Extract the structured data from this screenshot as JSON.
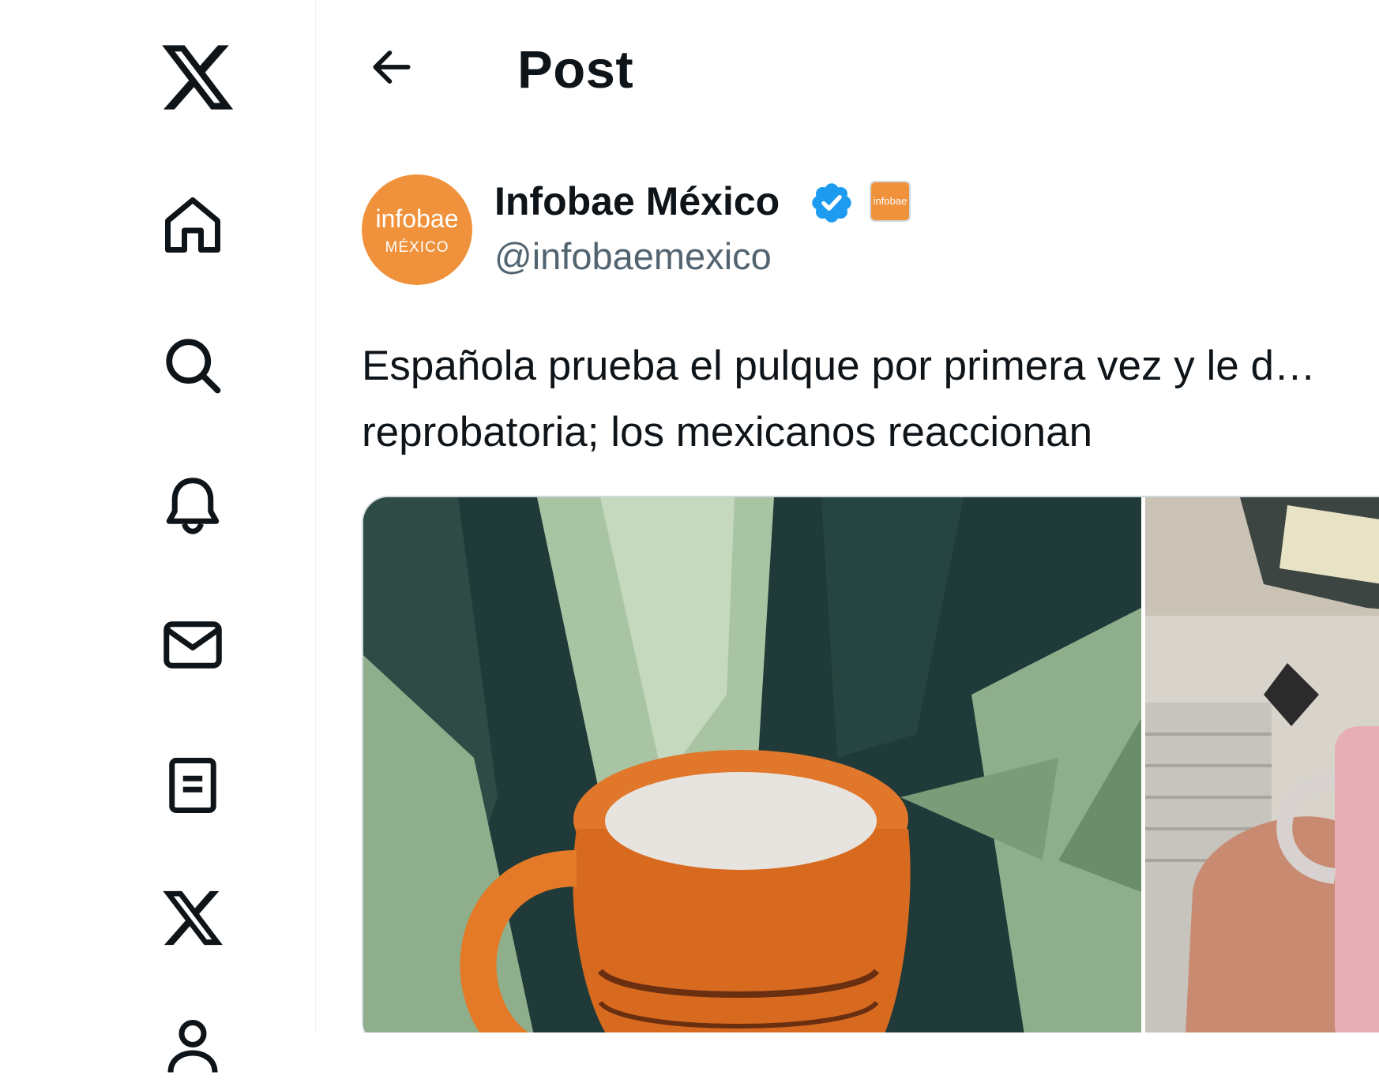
{
  "sidebar": {
    "logo": {
      "icon": "x-logo-icon"
    },
    "items": [
      {
        "key": "home",
        "icon": "home-icon"
      },
      {
        "key": "explore",
        "icon": "search-icon"
      },
      {
        "key": "notifications",
        "icon": "bell-icon"
      },
      {
        "key": "messages",
        "icon": "mail-icon"
      },
      {
        "key": "lists",
        "icon": "list-icon"
      },
      {
        "key": "premium",
        "icon": "x-logo-icon"
      },
      {
        "key": "profile",
        "icon": "person-icon"
      }
    ]
  },
  "header": {
    "back_icon": "arrow-left-icon",
    "title": "Post"
  },
  "post": {
    "author": {
      "avatar_line1": "infobae",
      "avatar_line2": "MÉXICO",
      "name": "Infobae México",
      "verified_icon": "verified-badge-icon",
      "affiliate_badge": "infobae",
      "handle": "@infobaemexico"
    },
    "text": "Española prueba el pulque por primera vez y le d… reprobatoria; los mexicanos reaccionan",
    "media": {
      "images": [
        {
          "desc_icon": "pulque-jarrito-image"
        },
        {
          "desc_icon": "pulqueria-street-image"
        }
      ]
    }
  },
  "colors": {
    "brand_orange": "#f0923b",
    "verified_blue": "#1d9bf0",
    "text_primary": "#0f1419",
    "text_secondary": "#536471",
    "border": "#cfd9de"
  }
}
